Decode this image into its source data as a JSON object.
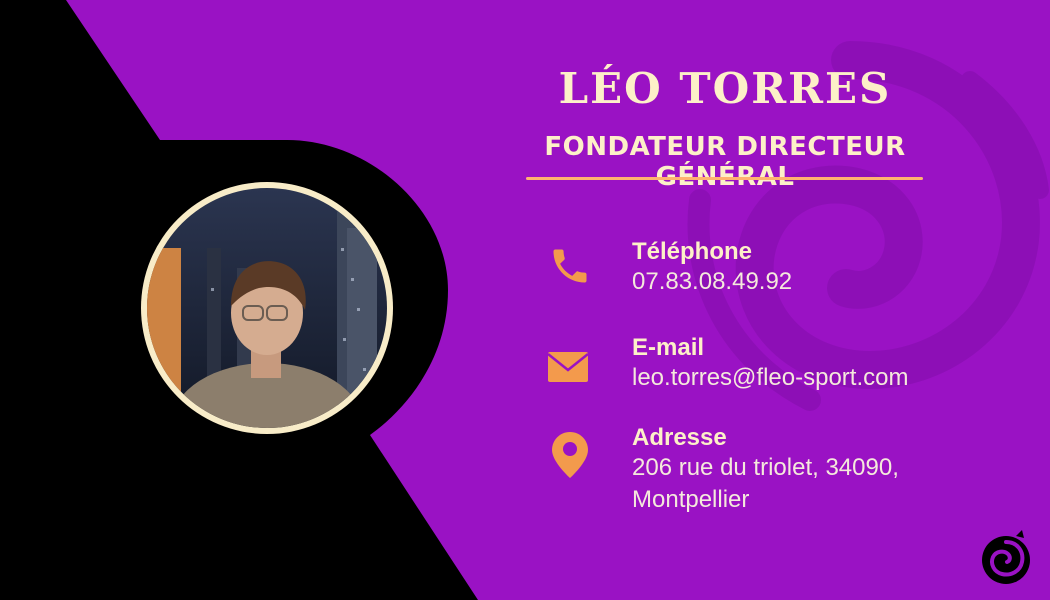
{
  "card": {
    "name": "LÉO TORRES",
    "role": "FONDATEUR DIRECTEUR GÉNÉRAL",
    "colors": {
      "background": "#9a12c4",
      "shape": "#000000",
      "accent": "#ffb370",
      "text": "#fdf0c8",
      "icon": "#f39a4c"
    }
  },
  "contacts": {
    "phone": {
      "icon": "phone-icon",
      "title": "Téléphone",
      "value": "07.83.08.49.92"
    },
    "email": {
      "icon": "mail-icon",
      "title": "E-mail",
      "value": "leo.torres@fleo-sport.com"
    },
    "address": {
      "icon": "location-pin-icon",
      "title": "Adresse",
      "line1": "206 rue du triolet, 34090,",
      "line2": "Montpellier"
    }
  },
  "branding": {
    "logo_icon": "dragon-logo-icon",
    "watermark_icon": "dragon-watermark-icon"
  },
  "photo": {
    "subject": "profile-photo"
  }
}
